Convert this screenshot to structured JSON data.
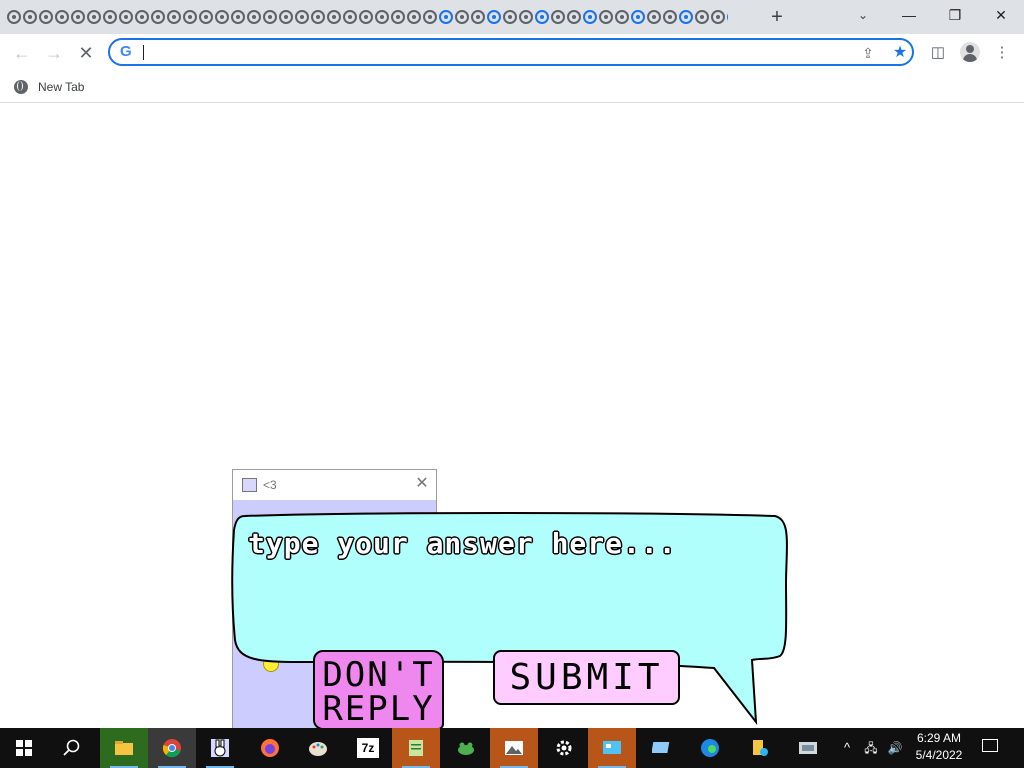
{
  "browser": {
    "tab_strip": {
      "favicon_count": 48,
      "new_tab_symbol": "+",
      "tab_search_symbol": "⌄",
      "window_controls": {
        "minimize": "—",
        "restore": "❐",
        "close": "✕"
      }
    },
    "toolbar": {
      "back_symbol": "←",
      "forward_symbol": "→",
      "stop_symbol": "✕",
      "omnibox": {
        "value": "",
        "logo": "G"
      },
      "share_icon": "⇪",
      "bookmark_star": "★",
      "side_panel_icon": "◫",
      "menu_icon": "⋮"
    },
    "bookmarks_bar": {
      "items": [
        {
          "label": "New Tab"
        }
      ]
    }
  },
  "popup": {
    "title": "<3",
    "close_symbol": "✕",
    "prompt": "type your answer here...",
    "answer_value": "",
    "buttons": {
      "dont_reply_line1": "DON'T",
      "dont_reply_line2": "REPLY",
      "submit": "SUBMIT"
    },
    "colors": {
      "bubble": "#b0fffc",
      "window_bg": "#ccccff",
      "dont_reply": "#ee88ee",
      "submit": "#ffccff"
    }
  },
  "taskbar": {
    "apps": [
      "start",
      "search",
      "file-explorer",
      "chrome",
      "bunny-app",
      "firefox",
      "paint",
      "7zip",
      "notepad-plus-plus",
      "frog-app",
      "photos",
      "settings",
      "control-panel",
      "remote-desktop",
      "edge",
      "file-share",
      "media-app"
    ],
    "tray_chevron": "^",
    "network_icon": "🖧",
    "volume_icon": "🔊",
    "clock_time": "6:29 AM",
    "clock_date": "5/4/2022",
    "seven_zip_label": "7z"
  }
}
